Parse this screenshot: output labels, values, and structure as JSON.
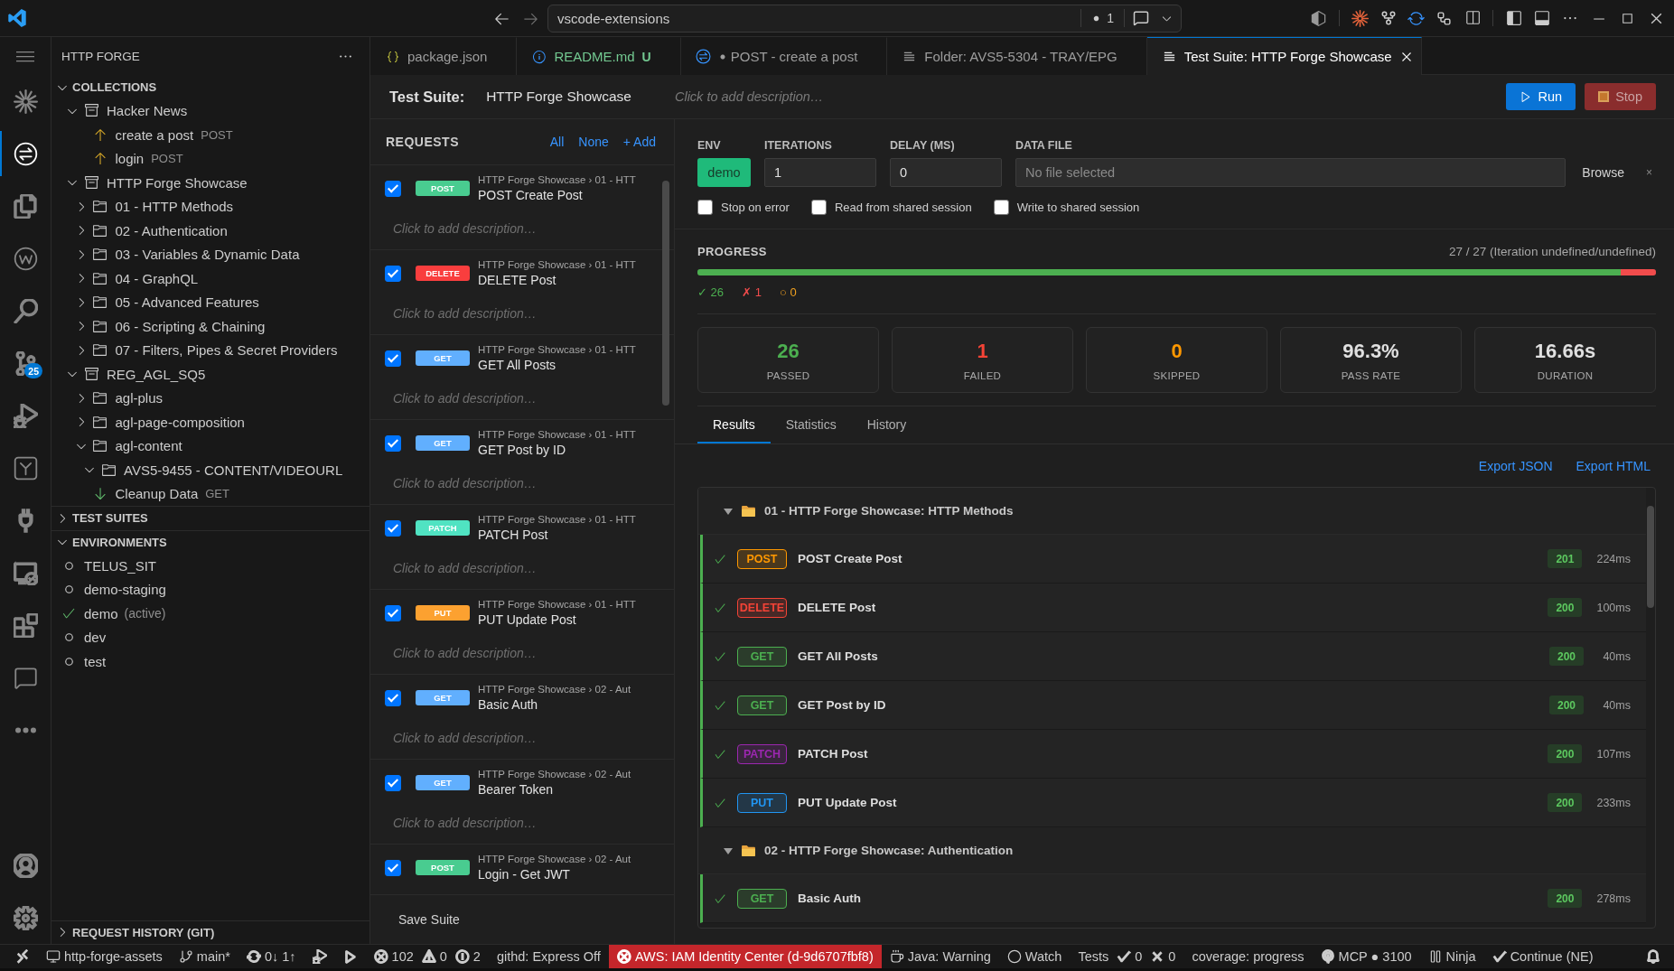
{
  "title_bar": {
    "search": "vscode-extensions",
    "indicator": "1"
  },
  "activity_bar": {
    "items": [
      {
        "kind": "burst",
        "selected": false
      },
      {
        "kind": "exchange",
        "selected": true
      },
      {
        "kind": "files",
        "selected": false
      },
      {
        "kind": "wcircle",
        "selected": false
      },
      {
        "kind": "search",
        "selected": false
      },
      {
        "kind": "branches",
        "selected": false,
        "badge": "25"
      },
      {
        "kind": "debug",
        "selected": false
      },
      {
        "kind": "tree",
        "selected": false
      },
      {
        "kind": "plug",
        "selected": false
      },
      {
        "kind": "remote",
        "selected": false
      },
      {
        "kind": "extensions",
        "selected": false
      },
      {
        "kind": "chat",
        "selected": false
      },
      {
        "kind": "more",
        "selected": false
      }
    ],
    "bottom": [
      {
        "kind": "account"
      },
      {
        "kind": "settings"
      }
    ]
  },
  "sidebar": {
    "title": "HTTP FORGE",
    "sections": [
      {
        "title": "COLLECTIONS",
        "expanded": true,
        "tree": [
          {
            "kind": "collection",
            "label": "Hacker News",
            "expanded": true,
            "children": [
              {
                "kind": "send",
                "label": "create a post",
                "method": "POST"
              },
              {
                "kind": "send",
                "label": "login",
                "method": "POST"
              }
            ]
          },
          {
            "kind": "collection",
            "label": "HTTP Forge Showcase",
            "expanded": true,
            "children": [
              {
                "kind": "folder",
                "label": "01 - HTTP Methods",
                "expanded": false
              },
              {
                "kind": "folder",
                "label": "02 - Authentication",
                "expanded": false
              },
              {
                "kind": "folder",
                "label": "03 - Variables & Dynamic Data",
                "expanded": false
              },
              {
                "kind": "folder",
                "label": "04 - GraphQL",
                "expanded": false
              },
              {
                "kind": "folder",
                "label": "05 - Advanced Features",
                "expanded": false
              },
              {
                "kind": "folder",
                "label": "06 - Scripting & Chaining",
                "expanded": false
              },
              {
                "kind": "folder",
                "label": "07 - Filters, Pipes & Secret Providers",
                "expanded": false
              }
            ]
          },
          {
            "kind": "collection",
            "label": "REG_AGL_SQ5",
            "expanded": true,
            "children": [
              {
                "kind": "folder",
                "label": "agl-plus",
                "expanded": false
              },
              {
                "kind": "folder",
                "label": "agl-page-composition",
                "expanded": false
              },
              {
                "kind": "folder",
                "label": "agl-content",
                "expanded": true,
                "children": [
                  {
                    "kind": "folder",
                    "label": "AVS5-9455 - CONTENT/VIDEOURL",
                    "expanded": true
                  }
                ]
              },
              {
                "kind": "fetch",
                "label": "Cleanup Data",
                "method": "GET"
              }
            ]
          }
        ]
      },
      {
        "title": "TEST SUITES",
        "expanded": false
      },
      {
        "title": "ENVIRONMENTS",
        "expanded": true,
        "environments": [
          {
            "name": "TELUS_SIT",
            "active": false
          },
          {
            "name": "demo-staging",
            "active": false
          },
          {
            "name": "demo",
            "active": true,
            "note": "(active)"
          },
          {
            "name": "dev",
            "active": false
          },
          {
            "name": "test",
            "active": false
          }
        ]
      },
      {
        "title": "REQUEST HISTORY (GIT)",
        "expanded": false
      }
    ]
  },
  "tabs": [
    {
      "kind": "json",
      "label": "package.json",
      "dirty": false,
      "selected": false
    },
    {
      "kind": "info",
      "label": "README.md",
      "decoration": "U",
      "dirty": false,
      "selected": false
    },
    {
      "kind": "request",
      "label": "POST - create a post",
      "dirty": true,
      "selected": false
    },
    {
      "kind": "list",
      "label": "Folder: AVS5-5304 - TRAY/EPG",
      "dirty": false,
      "selected": false
    },
    {
      "kind": "list",
      "label": "Test Suite: HTTP Forge Showcase",
      "dirty": false,
      "selected": true
    }
  ],
  "suite": {
    "label": "Test Suite:",
    "name": "HTTP Forge Showcase",
    "placeholder": "Click to add description…",
    "buttons": [
      {
        "kind": "run",
        "label": "Run",
        "disabled": false
      },
      {
        "kind": "stop",
        "label": "Stop",
        "disabled": true
      }
    ]
  },
  "requests": {
    "title": "REQUESTS",
    "links": [
      "All",
      "None",
      "+ Add"
    ],
    "items": [
      {
        "method": "POST",
        "color": "#49cc90",
        "path": "HTTP Forge Showcase › 01 - HTT",
        "name": "POST Create Post",
        "placeholder": "Click to add description…",
        "checked": true
      },
      {
        "method": "DELETE",
        "color": "#f93e3e",
        "path": "HTTP Forge Showcase › 01 - HTT",
        "name": "DELETE Post",
        "placeholder": "Click to add description…",
        "checked": true
      },
      {
        "method": "GET",
        "color": "#61affe",
        "path": "HTTP Forge Showcase › 01 - HTT",
        "name": "GET All Posts",
        "placeholder": "Click to add description…",
        "checked": true
      },
      {
        "method": "GET",
        "color": "#61affe",
        "path": "HTTP Forge Showcase › 01 - HTT",
        "name": "GET Post by ID",
        "placeholder": "Click to add description…",
        "checked": true
      },
      {
        "method": "PATCH",
        "color": "#50e3c2",
        "path": "HTTP Forge Showcase › 01 - HTT",
        "name": "PATCH Post",
        "placeholder": "Click to add description…",
        "checked": true
      },
      {
        "method": "PUT",
        "color": "#fca130",
        "path": "HTTP Forge Showcase › 01 - HTT",
        "name": "PUT Update Post",
        "placeholder": "Click to add description…",
        "checked": true
      },
      {
        "method": "GET",
        "color": "#61affe",
        "path": "HTTP Forge Showcase › 02 - Aut",
        "name": "Basic Auth",
        "placeholder": "Click to add description…",
        "checked": true
      },
      {
        "method": "GET",
        "color": "#61affe",
        "path": "HTTP Forge Showcase › 02 - Aut",
        "name": "Bearer Token",
        "placeholder": "Click to add description…",
        "checked": true
      },
      {
        "method": "POST",
        "color": "#49cc90",
        "path": "HTTP Forge Showcase › 02 - Aut",
        "name": "Login - Get JWT",
        "checked": true
      }
    ],
    "footer": "Save Suite"
  },
  "config": {
    "fields": [
      {
        "kind": "env",
        "label": "ENV",
        "value": "demo"
      },
      {
        "kind": "number",
        "label": "ITERATIONS",
        "value": "1"
      },
      {
        "kind": "number",
        "label": "DELAY (MS)",
        "value": "0"
      },
      {
        "kind": "file",
        "label": "DATA FILE",
        "placeholder": "No file selected",
        "browse": "Browse",
        "clear": "×"
      }
    ],
    "options": [
      {
        "label": "Stop on error",
        "checked": false
      },
      {
        "label": "Read from shared session",
        "checked": false
      },
      {
        "label": "Write to shared session",
        "checked": false
      }
    ]
  },
  "progress": {
    "title": "PROGRESS",
    "summary": "27 / 27 (Iteration undefined/undefined)",
    "segments": [
      {
        "level": 0.963,
        "color": "#4caf50"
      },
      {
        "level": 0.037,
        "color": "#f14c4c"
      }
    ],
    "tally": [
      {
        "text": "✓ 26",
        "color": "#4caf50"
      },
      {
        "text": "✗ 1",
        "color": "#f14c4c"
      },
      {
        "text": "○ 0",
        "color": "#f0a020"
      }
    ]
  },
  "stats": [
    {
      "value": "26",
      "label": "PASSED",
      "color": "#4caf50"
    },
    {
      "value": "1",
      "label": "FAILED",
      "color": "#f44336"
    },
    {
      "value": "0",
      "label": "SKIPPED",
      "color": "#ff9800"
    },
    {
      "value": "96.3%",
      "label": "PASS RATE",
      "color": "#e0e0e0"
    },
    {
      "value": "16.66s",
      "label": "DURATION",
      "color": "#e0e0e0"
    }
  ],
  "results": {
    "tabs": [
      {
        "label": "Results",
        "selected": true
      },
      {
        "label": "Statistics",
        "selected": false
      },
      {
        "label": "History",
        "selected": false
      }
    ],
    "exports": [
      "Export JSON",
      "Export HTML"
    ],
    "groups": [
      {
        "title": "01 - HTTP Forge Showcase: HTTP Methods",
        "expanded": true,
        "rows": [
          {
            "method": "POST",
            "color": "#ff9800",
            "name": "POST Create Post",
            "code": "201",
            "time": "224ms",
            "passed": true
          },
          {
            "method": "DELETE",
            "color": "#f44336",
            "name": "DELETE Post",
            "code": "200",
            "time": "100ms",
            "passed": true
          },
          {
            "method": "GET",
            "color": "#4caf50",
            "name": "GET All Posts",
            "code": "200",
            "time": "40ms",
            "passed": true
          },
          {
            "method": "GET",
            "color": "#4caf50",
            "name": "GET Post by ID",
            "code": "200",
            "time": "40ms",
            "passed": true
          },
          {
            "method": "PATCH",
            "color": "#9c27b0",
            "name": "PATCH Post",
            "code": "200",
            "time": "107ms",
            "passed": true
          },
          {
            "method": "PUT",
            "color": "#2196f3",
            "name": "PUT Update Post",
            "code": "200",
            "time": "233ms",
            "passed": true
          }
        ]
      },
      {
        "title": "02 - HTTP Forge Showcase: Authentication",
        "expanded": true,
        "rows": [
          {
            "method": "GET",
            "color": "#4caf50",
            "name": "Basic Auth",
            "code": "200",
            "time": "278ms",
            "passed": true
          }
        ]
      }
    ]
  },
  "status_bar": {
    "items": [
      {
        "alert": false,
        "parts": [
          {
            "kind": "remote"
          }
        ]
      },
      {
        "alert": false,
        "parts": [
          {
            "kind": "desktop",
            "text": "http-forge-assets"
          }
        ]
      },
      {
        "alert": false,
        "parts": [
          {
            "kind": "branch",
            "text": "main*"
          }
        ]
      },
      {
        "alert": false,
        "parts": [
          {
            "kind": "sync",
            "text": "0↓ 1↑"
          }
        ]
      },
      {
        "alert": false,
        "parts": [
          {
            "kind": "debug"
          }
        ]
      },
      {
        "alert": false,
        "parts": [
          {
            "kind": "play"
          }
        ]
      },
      {
        "alert": false,
        "parts": [
          {
            "kind": "error",
            "text": "102"
          },
          {
            "kind": "warning",
            "text": "0"
          },
          {
            "kind": "info",
            "text": "2"
          }
        ]
      },
      {
        "alert": false,
        "parts": [
          {
            "text": "githd: Express Off"
          }
        ]
      },
      {
        "alert": true,
        "parts": [
          {
            "kind": "error",
            "text": "AWS: IAM Identity Center (d-9d6707fbf8)"
          }
        ]
      },
      {
        "alert": false,
        "parts": [
          {
            "kind": "coffee",
            "text": "Java: Warning"
          }
        ]
      },
      {
        "alert": false,
        "parts": [
          {
            "kind": "circle",
            "text": "Watch"
          }
        ]
      },
      {
        "alert": false,
        "parts": [
          {
            "text": "Tests"
          },
          {
            "kind": "check",
            "text": "0"
          },
          {
            "kind": "cross",
            "text": "0"
          }
        ]
      },
      {
        "alert": false,
        "parts": [
          {
            "text": "coverage: progress"
          }
        ]
      },
      {
        "alert": false,
        "parts": [
          {
            "kind": "broadcast",
            "text": "MCP ● 3100"
          }
        ]
      },
      {
        "alert": false,
        "parts": [
          {
            "kind": "pause",
            "text": "Ninja"
          }
        ]
      },
      {
        "alert": false,
        "parts": [
          {
            "kind": "check",
            "text": "Continue (NE)"
          }
        ]
      },
      {
        "alert": false,
        "parts": [
          {
            "kind": "bell"
          }
        ]
      }
    ]
  }
}
